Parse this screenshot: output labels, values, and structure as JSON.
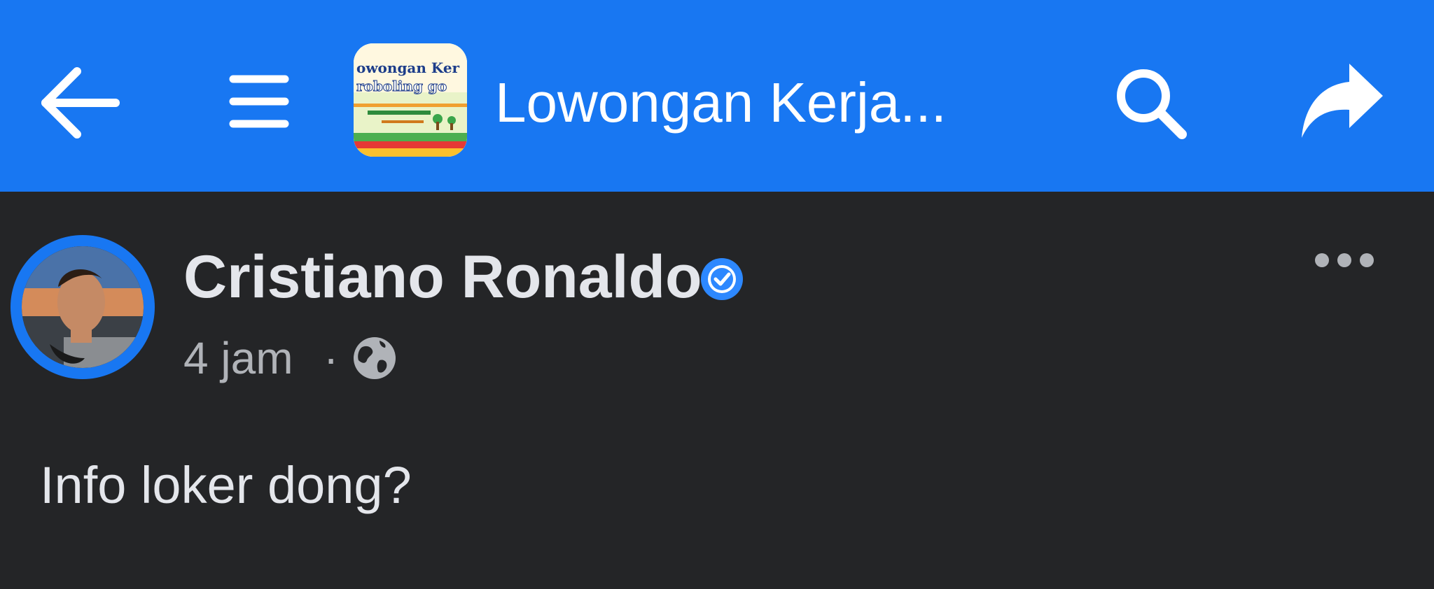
{
  "header": {
    "group_title": "Lowongan Kerja...",
    "thumbnail_text_line1": "owongan Ker",
    "thumbnail_text_line2": "roboling go",
    "back_icon": "arrow-left-icon",
    "menu_icon": "hamburger-menu-icon",
    "search_icon": "search-icon",
    "share_icon": "share-icon",
    "background_color": "#1877f2"
  },
  "post": {
    "author_name": "Cristiano Ronaldo",
    "verified_icon": "verified-badge-icon",
    "time": "4 jam",
    "separator": "·",
    "audience_icon": "globe-icon",
    "more_icon": "more-options-icon",
    "body_text": "Info loker dong?",
    "background_color": "#242527",
    "accent_color": "#1877f2"
  }
}
